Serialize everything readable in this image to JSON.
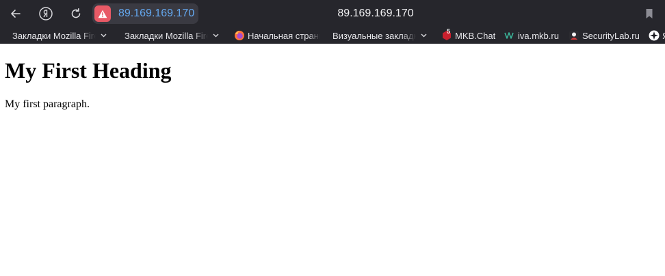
{
  "browser": {
    "url": "89.169.169.170",
    "title": "89.169.169.170",
    "colors": {
      "chrome_bg": "#26262c",
      "url_text": "#64a8f0",
      "security_warning": "#e85a66"
    },
    "icons": {
      "back": "arrow-left-icon",
      "yandex": "yandex-logo-icon",
      "reload": "reload-icon",
      "security": "warning-triangle-icon",
      "bookmark": "bookmark-icon"
    }
  },
  "bookmarks": [
    {
      "label": "Закладки Mozilla Firefox",
      "has_dropdown": true
    },
    {
      "label": "Закладки Mozilla Firefox",
      "has_dropdown": true
    },
    {
      "label": "Начальная страница",
      "icon": "firefox-icon"
    },
    {
      "label": "Визуальные закладки",
      "has_dropdown": true
    },
    {
      "label": "MKB.Chat",
      "icon": "mkb-chat-icon",
      "badge": "5"
    },
    {
      "label": "iva.mkb.ru",
      "icon": "iva-icon"
    },
    {
      "label": "SecurityLab.ru",
      "icon": "securitylab-icon"
    },
    {
      "label": "Я",
      "icon": "star-icon"
    }
  ],
  "page": {
    "heading": "My First Heading",
    "paragraph": "My first paragraph."
  }
}
